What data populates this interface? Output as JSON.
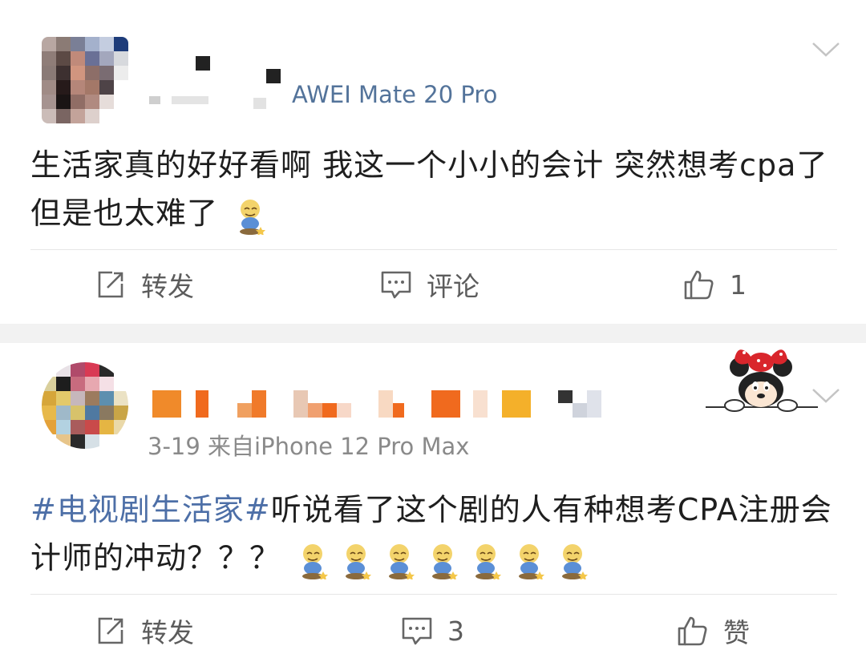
{
  "post1": {
    "device_meta": "AWEI Mate 20 Pro",
    "text": "生活家真的好好看啊 我这一个小小的会计 突然想考cpa了 但是也太难了",
    "actions": {
      "repost": "转发",
      "comment": "评论",
      "like_count": "1"
    }
  },
  "post2": {
    "meta": "3-19  来自iPhone 12 Pro Max",
    "topic": "#电视剧生活家#",
    "text": "听说看了这个剧的人有种想考CPA注册会计师的冲动？？？",
    "actions": {
      "repost": "转发",
      "comment_count": "3",
      "like_label": "赞"
    }
  },
  "icons": {
    "more": "chevron-down-icon",
    "repost": "share-icon",
    "comment": "comment-icon",
    "like": "thumbs-up-icon",
    "emoji": "doge-emoji-icon"
  },
  "colors": {
    "topic": "#4d6fa7",
    "meta": "#8a8a8a",
    "separator": "#f2f2f2"
  }
}
